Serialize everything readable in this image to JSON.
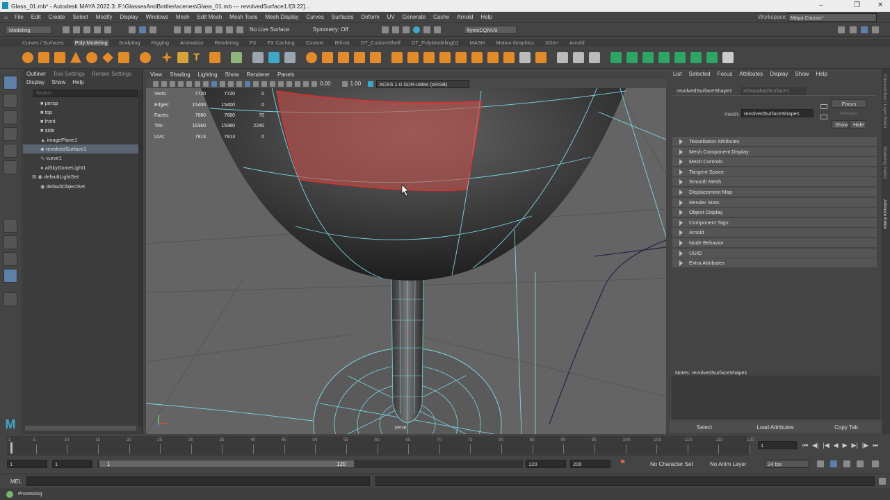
{
  "title": "Glass_01.mb* - Autodesk MAYA 2022.3: F:\\GlassesAndBottles\\scenes\\Glass_01.mb   ---   revolvedSurface1.f[3:22]...",
  "menu": [
    "File",
    "Edit",
    "Create",
    "Select",
    "Modify",
    "Display",
    "Windows",
    "Mesh",
    "Edit Mesh",
    "Mesh Tools",
    "Mesh Display",
    "Curves",
    "Surfaces",
    "Deform",
    "UV",
    "Generate",
    "Cache",
    "Arnold",
    "Help"
  ],
  "workspace_label": "Workspace:",
  "workspace_value": "Maya Classic*",
  "status": {
    "mode": "Modeling",
    "live": "No Live Surface",
    "symmetry": "Symmetry: Off",
    "user": "flyntcCQNV9"
  },
  "shelf_tabs": [
    "Curves / Surfaces",
    "Poly Modeling",
    "Sculpting",
    "Rigging",
    "Animation",
    "Rendering",
    "FX",
    "FX Caching",
    "Custom",
    "Bifrost",
    "DT_CustomShelf",
    "DT_PolyModeling01",
    "MASH",
    "Motion Graphics",
    "XGen",
    "Arnold"
  ],
  "outliner": {
    "tabs": [
      "Outliner",
      "Tool Settings",
      "Render Settings"
    ],
    "menu": [
      "Display",
      "Show",
      "Help"
    ],
    "search_placeholder": "Search...",
    "items": [
      "persp",
      "top",
      "front",
      "side",
      "imagePlane1",
      "revolvedSurface1",
      "curve1",
      "aiSkyDomeLight1",
      "defaultLightSet",
      "defaultObjectSet"
    ]
  },
  "viewport": {
    "menu": [
      "View",
      "Shading",
      "Lighting",
      "Show",
      "Renderer",
      "Panels"
    ],
    "exposure": "0.00",
    "gamma": "1.00",
    "colorspace": "ACES 1.0 SDR-video (sRGB)",
    "camera_label": "persp",
    "hud": [
      [
        "Verts:",
        "7720",
        "7720",
        "0"
      ],
      [
        "Edges:",
        "15400",
        "15400",
        "0"
      ],
      [
        "Faces:",
        "7680",
        "7680",
        "70"
      ],
      [
        "Tris:",
        "15360",
        "15360",
        "2240"
      ],
      [
        "UVs:",
        "7913",
        "7913",
        "0"
      ]
    ]
  },
  "attr": {
    "menu": [
      "List",
      "Selected",
      "Focus",
      "Attributes",
      "Display",
      "Show",
      "Help"
    ],
    "tabs": [
      "revolvedSurfaceShape1",
      "aiStandardSurface1"
    ],
    "mesh_label": "mesh:",
    "mesh_value": "revolvedSurfaceShape1",
    "focus": "Focus",
    "presets": "Presets",
    "show": "Show",
    "hide": "Hide",
    "sections": [
      "Tessellation Attributes",
      "Mesh Component Display",
      "Mesh Controls",
      "Tangent Space",
      "Smooth Mesh",
      "Displacement Map",
      "Render Stats",
      "Object Display",
      "Component Tags",
      "Arnold",
      "Node Behavior",
      "UUID",
      "Extra Attributes"
    ],
    "notes": "Notes:  revolvedSurfaceShape1",
    "buttons": [
      "Select",
      "Load Attributes",
      "Copy Tab"
    ],
    "side_tabs": [
      "Channel Box / Layer Editor",
      "Modeling Toolkit",
      "Attribute Editor"
    ]
  },
  "timeline": {
    "ticks": [
      "1",
      "5",
      "10",
      "15",
      "20",
      "25",
      "30",
      "35",
      "40",
      "45",
      "50",
      "55",
      "60",
      "65",
      "70",
      "75",
      "80",
      "85",
      "90",
      "95",
      "100",
      "105",
      "110",
      "115",
      "120"
    ],
    "current": "1",
    "range_start": "1",
    "range_inner_start": "1",
    "range_slider_start": "1",
    "range_slider_end": "120",
    "range_end": "120",
    "anim_end": "200",
    "char_set": "No Character Set",
    "anim_layer": "No Anim Layer",
    "fps": "24 fps"
  },
  "cmd_label": "MEL",
  "help_text": "Processing"
}
